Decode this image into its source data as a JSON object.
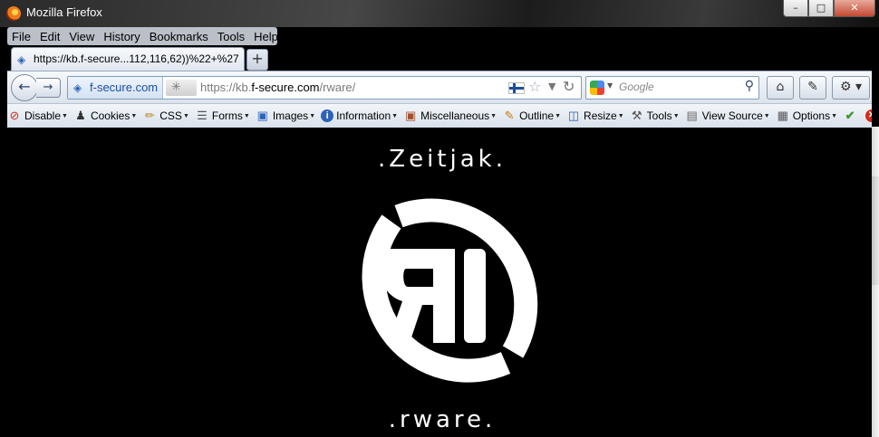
{
  "window": {
    "title": "Mozilla Firefox"
  },
  "menubar": {
    "items": [
      "File",
      "Edit",
      "View",
      "History",
      "Bookmarks",
      "Tools",
      "Help"
    ]
  },
  "tab": {
    "title": "https://kb.f-secure...112,116,62))%22+%27",
    "new_tab_symbol": "+"
  },
  "navbar": {
    "identity": "f-secure.com",
    "url_prefix": "https://kb.",
    "url_domain": "f-secure.com",
    "url_path": "/rware/",
    "search_placeholder": "Google"
  },
  "toolbar": {
    "items": [
      {
        "label": "Disable",
        "icon": "no-icon",
        "dropdown": true
      },
      {
        "label": "Cookies",
        "icon": "person-icon",
        "dropdown": true
      },
      {
        "label": "CSS",
        "icon": "wand-icon",
        "dropdown": true
      },
      {
        "label": "Forms",
        "icon": "form-icon",
        "dropdown": true
      },
      {
        "label": "Images",
        "icon": "image-icon",
        "dropdown": true
      },
      {
        "label": "Information",
        "icon": "info-icon",
        "dropdown": true
      },
      {
        "label": "Miscellaneous",
        "icon": "chest-icon",
        "dropdown": true
      },
      {
        "label": "Outline",
        "icon": "pencil-icon",
        "dropdown": true
      },
      {
        "label": "Resize",
        "icon": "resize-icon",
        "dropdown": true
      },
      {
        "label": "Tools",
        "icon": "tools-icon",
        "dropdown": true
      },
      {
        "label": "View Source",
        "icon": "page-icon",
        "dropdown": true
      },
      {
        "label": "Options",
        "icon": "options-icon",
        "dropdown": true
      }
    ],
    "status_icons": [
      "check-icon",
      "error-icon",
      "check-icon"
    ],
    "colors": {
      "check": "#3a9a2a",
      "error": "#d8281c"
    }
  },
  "page": {
    "top_text": ".Zeitjak.",
    "bottom_text": ".rware.",
    "logo_letters": "RI",
    "colors": {
      "background": "#000000",
      "foreground": "#ffffff"
    }
  }
}
